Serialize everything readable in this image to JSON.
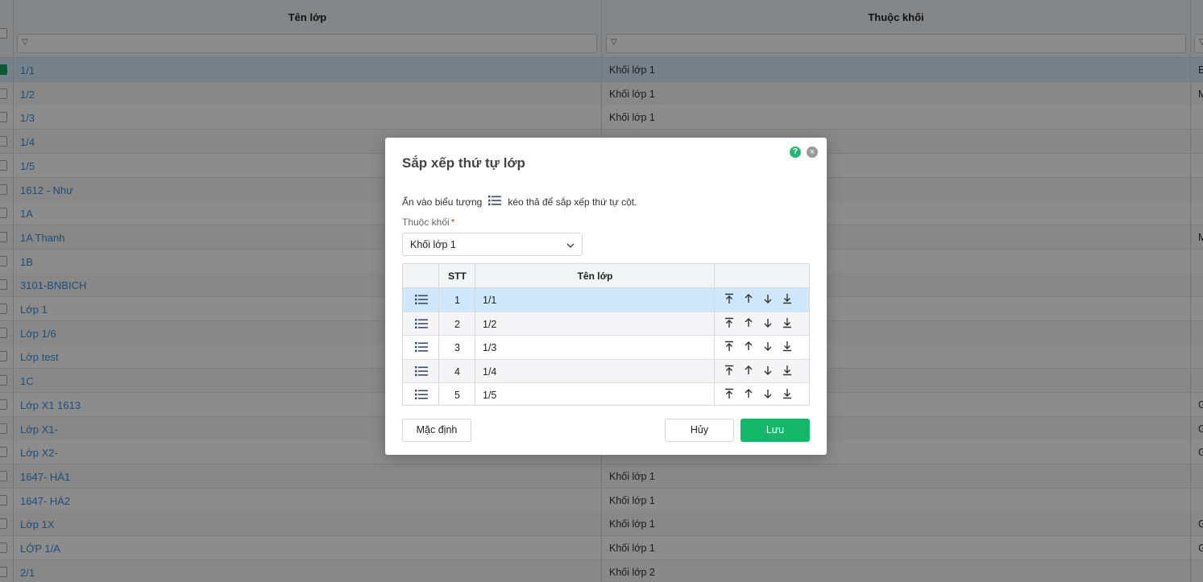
{
  "grid": {
    "columns": [
      "Tên lớp",
      "Thuộc khối"
    ],
    "rows": [
      {
        "name": "1/1",
        "block": "Khối lớp 1",
        "extra": "E",
        "selected": true
      },
      {
        "name": "1/2",
        "block": "Khối lớp 1",
        "extra": "M"
      },
      {
        "name": "1/3",
        "block": "Khối lớp 1",
        "extra": ""
      },
      {
        "name": "1/4",
        "block": "",
        "extra": ""
      },
      {
        "name": "1/5",
        "block": "",
        "extra": ""
      },
      {
        "name": "1612 - Như",
        "block": "",
        "extra": ""
      },
      {
        "name": "1A",
        "block": "",
        "extra": ""
      },
      {
        "name": "1A Thanh",
        "block": "",
        "extra": "M"
      },
      {
        "name": "1B",
        "block": "",
        "extra": ""
      },
      {
        "name": "3101-BNBICH",
        "block": "",
        "extra": ""
      },
      {
        "name": "Lớp 1",
        "block": "",
        "extra": ""
      },
      {
        "name": "Lớp 1/6",
        "block": "",
        "extra": ""
      },
      {
        "name": "Lớp test",
        "block": "",
        "extra": ""
      },
      {
        "name": "1C",
        "block": "",
        "extra": ""
      },
      {
        "name": "Lớp X1 1613",
        "block": "",
        "extra": "G"
      },
      {
        "name": "Lớp X1-",
        "block": "",
        "extra": "G"
      },
      {
        "name": "Lớp X2-",
        "block": "",
        "extra": "G"
      },
      {
        "name": "1647- HÀ1",
        "block": "Khối lớp 1",
        "extra": ""
      },
      {
        "name": "1647- HÀ2",
        "block": "Khối lớp 1",
        "extra": ""
      },
      {
        "name": "Lớp 1X",
        "block": "Khối lớp 1",
        "extra": "G"
      },
      {
        "name": "LỚP 1/A",
        "block": "Khối lớp 1",
        "extra": "G"
      },
      {
        "name": "2/1",
        "block": "Khối lớp 2",
        "extra": ""
      }
    ]
  },
  "modal": {
    "title": "Sắp xếp thứ tự lớp",
    "help_icon": "?",
    "close_icon": "×",
    "hint_before": "Ẩn vào biểu tượng",
    "hint_after": "kéo thả để sắp xếp thứ tự cột.",
    "block_label": "Thuộc khối",
    "required_mark": "*",
    "block_value": "Khối lớp 1",
    "table": {
      "headers": {
        "stt": "STT",
        "name": "Tên lớp"
      },
      "rows": [
        {
          "stt": "1",
          "name": "1/1",
          "selected": true
        },
        {
          "stt": "2",
          "name": "1/2"
        },
        {
          "stt": "3",
          "name": "1/3"
        },
        {
          "stt": "4",
          "name": "1/4"
        },
        {
          "stt": "5",
          "name": "1/5"
        }
      ]
    },
    "buttons": {
      "default": "Mặc định",
      "cancel": "Hủy",
      "save": "Lưu"
    }
  }
}
